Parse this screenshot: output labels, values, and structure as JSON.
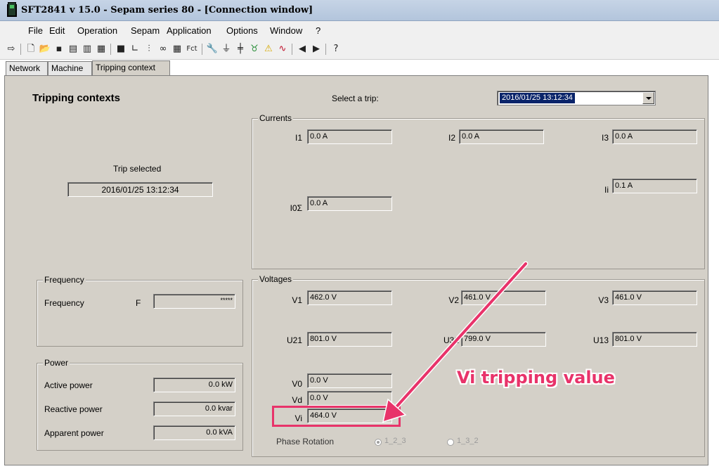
{
  "window": {
    "title": "SFT2841  v 15.0 - Sepam series 80 - [Connection window]"
  },
  "menu": [
    "File",
    "Edit",
    "Operation",
    "Sepam",
    "Application",
    "Options",
    "Window",
    "?"
  ],
  "toolbar": {
    "icons": [
      "connect-icon",
      "new-icon",
      "open-icon",
      "save-icon",
      "print-icon",
      "print-preview-icon",
      "print-setup-icon",
      "disk-icon",
      "curve-icon",
      "settings-icon",
      "logic-icon",
      "table-icon",
      "function-icon",
      "wrench-icon",
      "diagnosis-icon",
      "network-icon",
      "sepam-icon",
      "alarm-icon",
      "waveform-icon",
      "previous-icon",
      "next-icon",
      "help-icon"
    ],
    "fct_label": "Fct"
  },
  "tabs": [
    "Network",
    "Machine",
    "Tripping context"
  ],
  "active_tab": "Tripping context",
  "page": {
    "heading": "Tripping contexts",
    "select_label": "Select a trip:",
    "selected_trip": "2016/01/25 13:12:34",
    "trip_selected_label": "Trip selected",
    "trip_selected_value": "2016/01/25 13:12:34"
  },
  "currents": {
    "title": "Currents",
    "I1": {
      "label": "I1",
      "value": "0.0 A"
    },
    "I2": {
      "label": "I2",
      "value": "0.0 A"
    },
    "I3": {
      "label": "I3",
      "value": "0.0 A"
    },
    "Ii": {
      "label": "Ii",
      "value": "0.1 A"
    },
    "I0": {
      "label": "I0Σ",
      "value": "0.0 A"
    }
  },
  "frequency": {
    "title": "Frequency",
    "label": "Frequency",
    "symbol": "F",
    "value": "*****"
  },
  "power": {
    "title": "Power",
    "active": {
      "label": "Active power",
      "value": "0.0 kW"
    },
    "reactive": {
      "label": "Reactive power",
      "value": "0.0 kvar"
    },
    "apparent": {
      "label": "Apparent power",
      "value": "0.0 kVA"
    }
  },
  "voltages": {
    "title": "Voltages",
    "V1": {
      "label": "V1",
      "value": "462.0 V"
    },
    "V2": {
      "label": "V2",
      "value": "461.0 V"
    },
    "V3": {
      "label": "V3",
      "value": "461.0 V"
    },
    "U21": {
      "label": "U21",
      "value": "801.0 V"
    },
    "U32": {
      "label": "U32",
      "value": "799.0 V"
    },
    "U13": {
      "label": "U13",
      "value": "801.0 V"
    },
    "V0": {
      "label": "V0",
      "value": "0.0 V"
    },
    "Vd": {
      "label": "Vd",
      "value": "0.0 V"
    },
    "Vi": {
      "label": "Vi",
      "value": "464.0 V"
    },
    "phase_rotation_label": "Phase Rotation",
    "rotation_options": [
      "1_2_3",
      "1_3_2"
    ],
    "rotation_selected": "1_2_3"
  },
  "annotation": {
    "text": "Vi tripping value",
    "color": "#e8336a"
  },
  "colors": {
    "panel": "#d4d0c8",
    "titlebar": "#b9cbe0",
    "selection": "#0a246a"
  }
}
